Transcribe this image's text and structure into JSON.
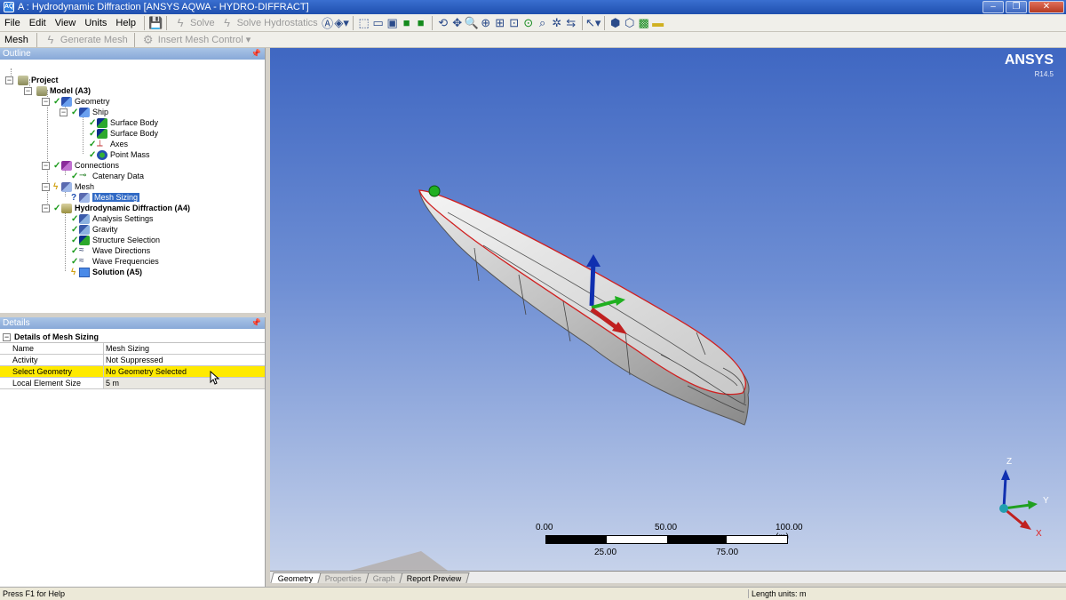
{
  "window": {
    "title": "A : Hydrodynamic Diffraction [ANSYS AQWA - HYDRO-DIFFRACT]",
    "app_icon": "AQ"
  },
  "menu": [
    "File",
    "Edit",
    "View",
    "Units",
    "Help"
  ],
  "toolbar": {
    "solve_label": "Solve",
    "solve_hydrostatics_label": "Solve Hydrostatics"
  },
  "mesh_toolbar": {
    "mesh_label": "Mesh",
    "generate_label": "Generate Mesh",
    "insert_label": "Insert Mesh Control"
  },
  "outline": {
    "header": "Outline",
    "items": [
      {
        "label": "Project",
        "bold": true
      },
      {
        "label": "Model (A3)",
        "bold": true
      },
      {
        "label": "Geometry"
      },
      {
        "label": "Ship"
      },
      {
        "label": "Surface Body"
      },
      {
        "label": "Surface Body"
      },
      {
        "label": "Axes"
      },
      {
        "label": "Point Mass"
      },
      {
        "label": "Connections"
      },
      {
        "label": "Catenary Data"
      },
      {
        "label": "Mesh"
      },
      {
        "label": "Mesh Sizing",
        "selected": true
      },
      {
        "label": "Hydrodynamic Diffraction (A4)",
        "bold": true
      },
      {
        "label": "Analysis Settings"
      },
      {
        "label": "Gravity"
      },
      {
        "label": "Structure Selection"
      },
      {
        "label": "Wave Directions"
      },
      {
        "label": "Wave Frequencies"
      },
      {
        "label": "Solution (A5)",
        "bold": true
      }
    ]
  },
  "details": {
    "header": "Details",
    "group": "Details of Mesh Sizing",
    "rows": [
      {
        "key": "Name",
        "value": "Mesh Sizing"
      },
      {
        "key": "Activity",
        "value": "Not Suppressed"
      },
      {
        "key": "Select Geometry",
        "value": "No Geometry Selected",
        "highlight": true
      },
      {
        "key": "Local Element Size",
        "value": "5 m"
      }
    ]
  },
  "viewport": {
    "brand": "ANSYS",
    "version": "R14.5",
    "axis_labels": {
      "z": "Z",
      "y": "Y",
      "x": "X"
    },
    "scale": {
      "top": [
        "0.00",
        "50.00",
        "100.00 (m)"
      ],
      "bottom": [
        "25.00",
        "75.00"
      ]
    }
  },
  "tabs": [
    "Geometry",
    "Properties",
    "Graph",
    "Report Preview"
  ],
  "status": {
    "left": "Press F1 for Help",
    "right": "Length units: m"
  },
  "colors": {
    "highlight": "#ffea00",
    "selection": "#316ac5",
    "viewport_top": "#3f67c2",
    "viewport_bottom": "#c6d2ea"
  }
}
